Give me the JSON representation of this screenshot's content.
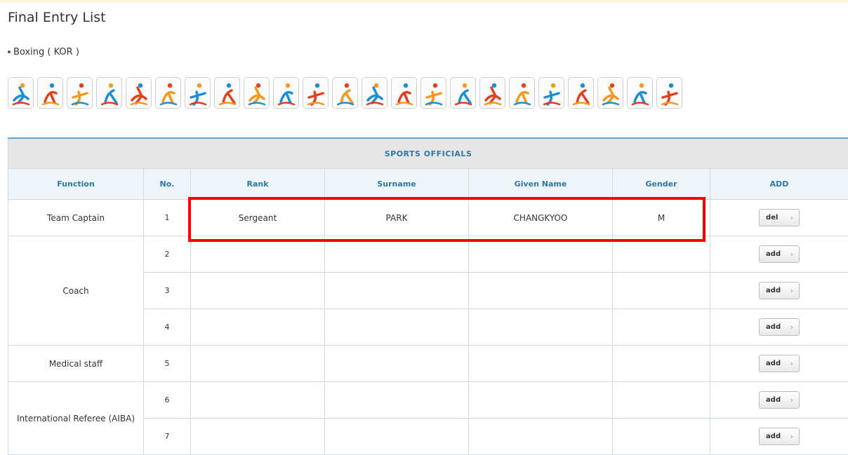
{
  "page": {
    "title": "Final Entry List",
    "subtitle": "Boxing ( KOR )"
  },
  "sports": [
    {
      "icon": "shooting-icon"
    },
    {
      "icon": "archery-icon"
    },
    {
      "icon": "basketball-icon"
    },
    {
      "icon": "athletics-icon"
    },
    {
      "icon": "cycling-icon"
    },
    {
      "icon": "fencing-icon"
    },
    {
      "icon": "football-icon"
    },
    {
      "icon": "golf-icon"
    },
    {
      "icon": "gymnastics-icon"
    },
    {
      "icon": "handball-icon"
    },
    {
      "icon": "hockey-icon"
    },
    {
      "icon": "judo-icon"
    },
    {
      "icon": "modern-pentathlon-icon"
    },
    {
      "icon": "rowing-icon"
    },
    {
      "icon": "running-icon"
    },
    {
      "icon": "boxing-icon"
    },
    {
      "icon": "sailing-icon"
    },
    {
      "icon": "swimming-icon"
    },
    {
      "icon": "triathlon-icon"
    },
    {
      "icon": "diving-icon"
    },
    {
      "icon": "multi-sport-icon"
    },
    {
      "icon": "taekwondo-icon"
    },
    {
      "icon": "volleyball-icon"
    }
  ],
  "table": {
    "section_title": "SPORTS OFFICIALS",
    "columns": [
      "Function",
      "No.",
      "Rank",
      "Surname",
      "Given Name",
      "Gender",
      "ADD"
    ],
    "rows": [
      {
        "function": "Team Captain",
        "no": "1",
        "rank": "Sergeant",
        "surname": "PARK",
        "given_name": "CHANGKYOO",
        "gender": "M",
        "action": "del"
      },
      {
        "function": "Coach",
        "no": "2",
        "rank": "",
        "surname": "",
        "given_name": "",
        "gender": "",
        "action": "add"
      },
      {
        "function": "",
        "no": "3",
        "rank": "",
        "surname": "",
        "given_name": "",
        "gender": "",
        "action": "add"
      },
      {
        "function": "",
        "no": "4",
        "rank": "",
        "surname": "",
        "given_name": "",
        "gender": "",
        "action": "add"
      },
      {
        "function": "Medical staff",
        "no": "5",
        "rank": "",
        "surname": "",
        "given_name": "",
        "gender": "",
        "action": "add"
      },
      {
        "function": "International Referee (AIBA)",
        "no": "6",
        "rank": "",
        "surname": "",
        "given_name": "",
        "gender": "",
        "action": "add"
      },
      {
        "function": "",
        "no": "7",
        "rank": "",
        "surname": "",
        "given_name": "",
        "gender": "",
        "action": "add"
      }
    ],
    "button_chevron": "›"
  },
  "colors": {
    "header_text": "#2c79a9",
    "highlight": "#ff0000",
    "icon_orange": "#f39a1e",
    "icon_blue": "#1b8fd1",
    "icon_red": "#e0401e"
  }
}
